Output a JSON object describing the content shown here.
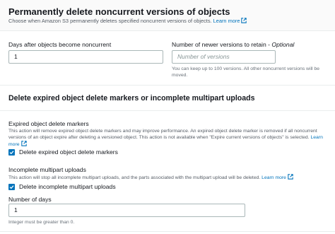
{
  "noncurrent": {
    "title": "Permanently delete noncurrent versions of objects",
    "description": "Choose when Amazon S3 permanently deletes specified noncurrent versions of objects.",
    "learn_more": "Learn more",
    "days_label": "Days after objects become noncurrent",
    "days_value": "1",
    "versions_label": "Number of newer versions to retain - ",
    "versions_label_optional": "Optional",
    "versions_placeholder": "Number of versions",
    "versions_hint": "You can keep up to 100 versions. All other noncurrent versions will be moved."
  },
  "expired": {
    "title": "Delete expired object delete markers or incomplete multipart uploads",
    "markers_title": "Expired object delete markers",
    "markers_desc": "This action will remove expired object delete markers and may improve performance. An expired object delete marker is removed if all noncurrent versions of an object expire after deleting a versioned object. This action is not available when \"Expire current versions of objects\" is selected.",
    "learn_more": "Learn more",
    "markers_checkbox_label": "Delete expired object delete markers",
    "markers_checked": true,
    "multipart_title": "Incomplete multipart uploads",
    "multipart_desc": "This action will stop all incomplete multipart uploads, and the parts associated with the multipart upload will be deleted.",
    "multipart_checkbox_label": "Delete incomplete multipart uploads",
    "multipart_checked": true,
    "days_label": "Number of days",
    "days_value": "1",
    "days_hint": "Integer must be greater than 0."
  },
  "colors": {
    "link": "#0073bb",
    "checkbox": "#0073bb",
    "header_bg": "#fafafa"
  },
  "icons": {
    "external": "external-link-icon",
    "check": "checkmark-icon"
  }
}
